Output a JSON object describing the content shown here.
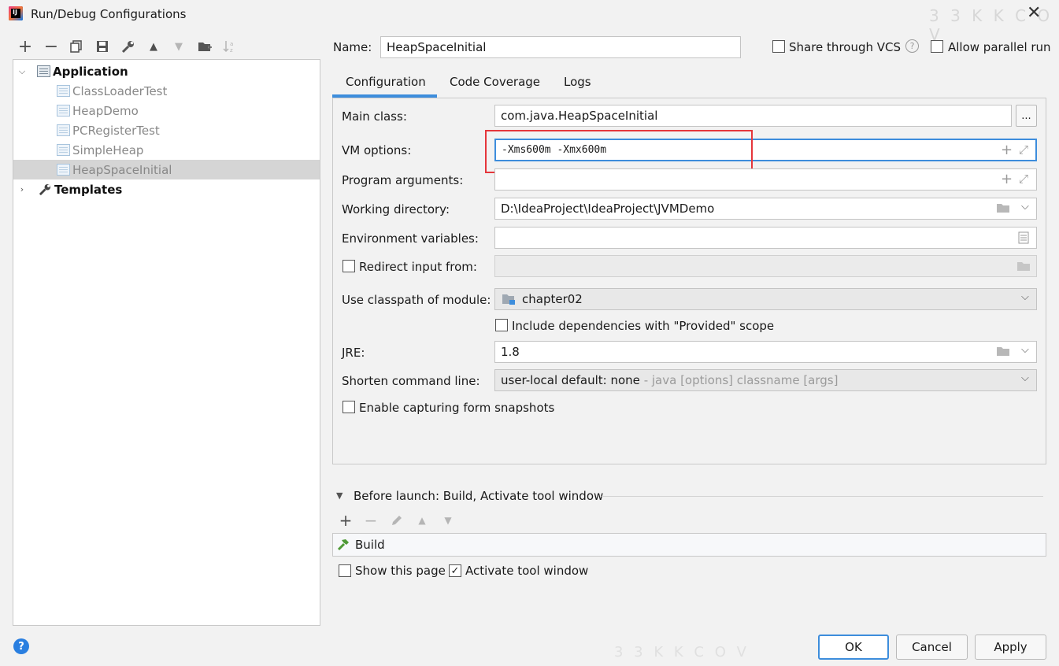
{
  "window": {
    "title": "Run/Debug Configurations",
    "app_icon": "intellij-icon",
    "watermark": "3 3 K K C O V"
  },
  "toolbar": {
    "icons": [
      "add-icon",
      "remove-icon",
      "copy-icon",
      "save-icon",
      "wrench-icon",
      "move-up-icon",
      "move-down-icon",
      "folder-add-icon",
      "sort-icon"
    ],
    "add": "+",
    "remove": "−",
    "up": "▲",
    "down": "▼"
  },
  "tree": {
    "application": "Application",
    "items": [
      "ClassLoaderTest",
      "HeapDemo",
      "PCRegisterTest",
      "SimpleHeap",
      "HeapSpaceInitial"
    ],
    "selected": "HeapSpaceInitial",
    "templates": "Templates"
  },
  "header": {
    "name_label": "Name:",
    "name_value": "HeapSpaceInitial",
    "share_vcs": "Share through VCS",
    "allow_parallel": "Allow parallel run"
  },
  "tabs": [
    "Configuration",
    "Code Coverage",
    "Logs"
  ],
  "active_tab": "Configuration",
  "form": {
    "main_class_label": "Main class:",
    "main_class_value": "com.java.HeapSpaceInitial",
    "browse_label": "...",
    "vm_options_label": "VM options:",
    "vm_options_value": "-Xms600m -Xmx600m",
    "program_args_label": "Program arguments:",
    "program_args_value": "",
    "working_dir_label": "Working directory:",
    "working_dir_value": "D:\\IdeaProject\\IdeaProject\\JVMDemo",
    "env_vars_label": "Environment variables:",
    "env_vars_value": "",
    "redirect_label": "Redirect input from:",
    "classpath_label": "Use classpath of module:",
    "classpath_value": "chapter02",
    "include_deps_label": "Include dependencies with \"Provided\" scope",
    "jre_label": "JRE:",
    "jre_value": "1.8",
    "shorten_label": "Shorten command line:",
    "shorten_value": "user-local default: none",
    "shorten_hint": " - java [options] classname [args]",
    "snapshots_label": "Enable capturing form snapshots"
  },
  "before_launch": {
    "title": "Before launch: Build, Activate tool window",
    "build_item": "Build",
    "show_page": "Show this page",
    "activate_tool": "Activate tool window",
    "activate_checked": true
  },
  "buttons": {
    "ok": "OK",
    "cancel": "Cancel",
    "apply": "Apply",
    "help": "?"
  },
  "colors": {
    "accent": "#3d8ddc",
    "highlight": "#e5363b",
    "selection": "#d5d5d5"
  }
}
